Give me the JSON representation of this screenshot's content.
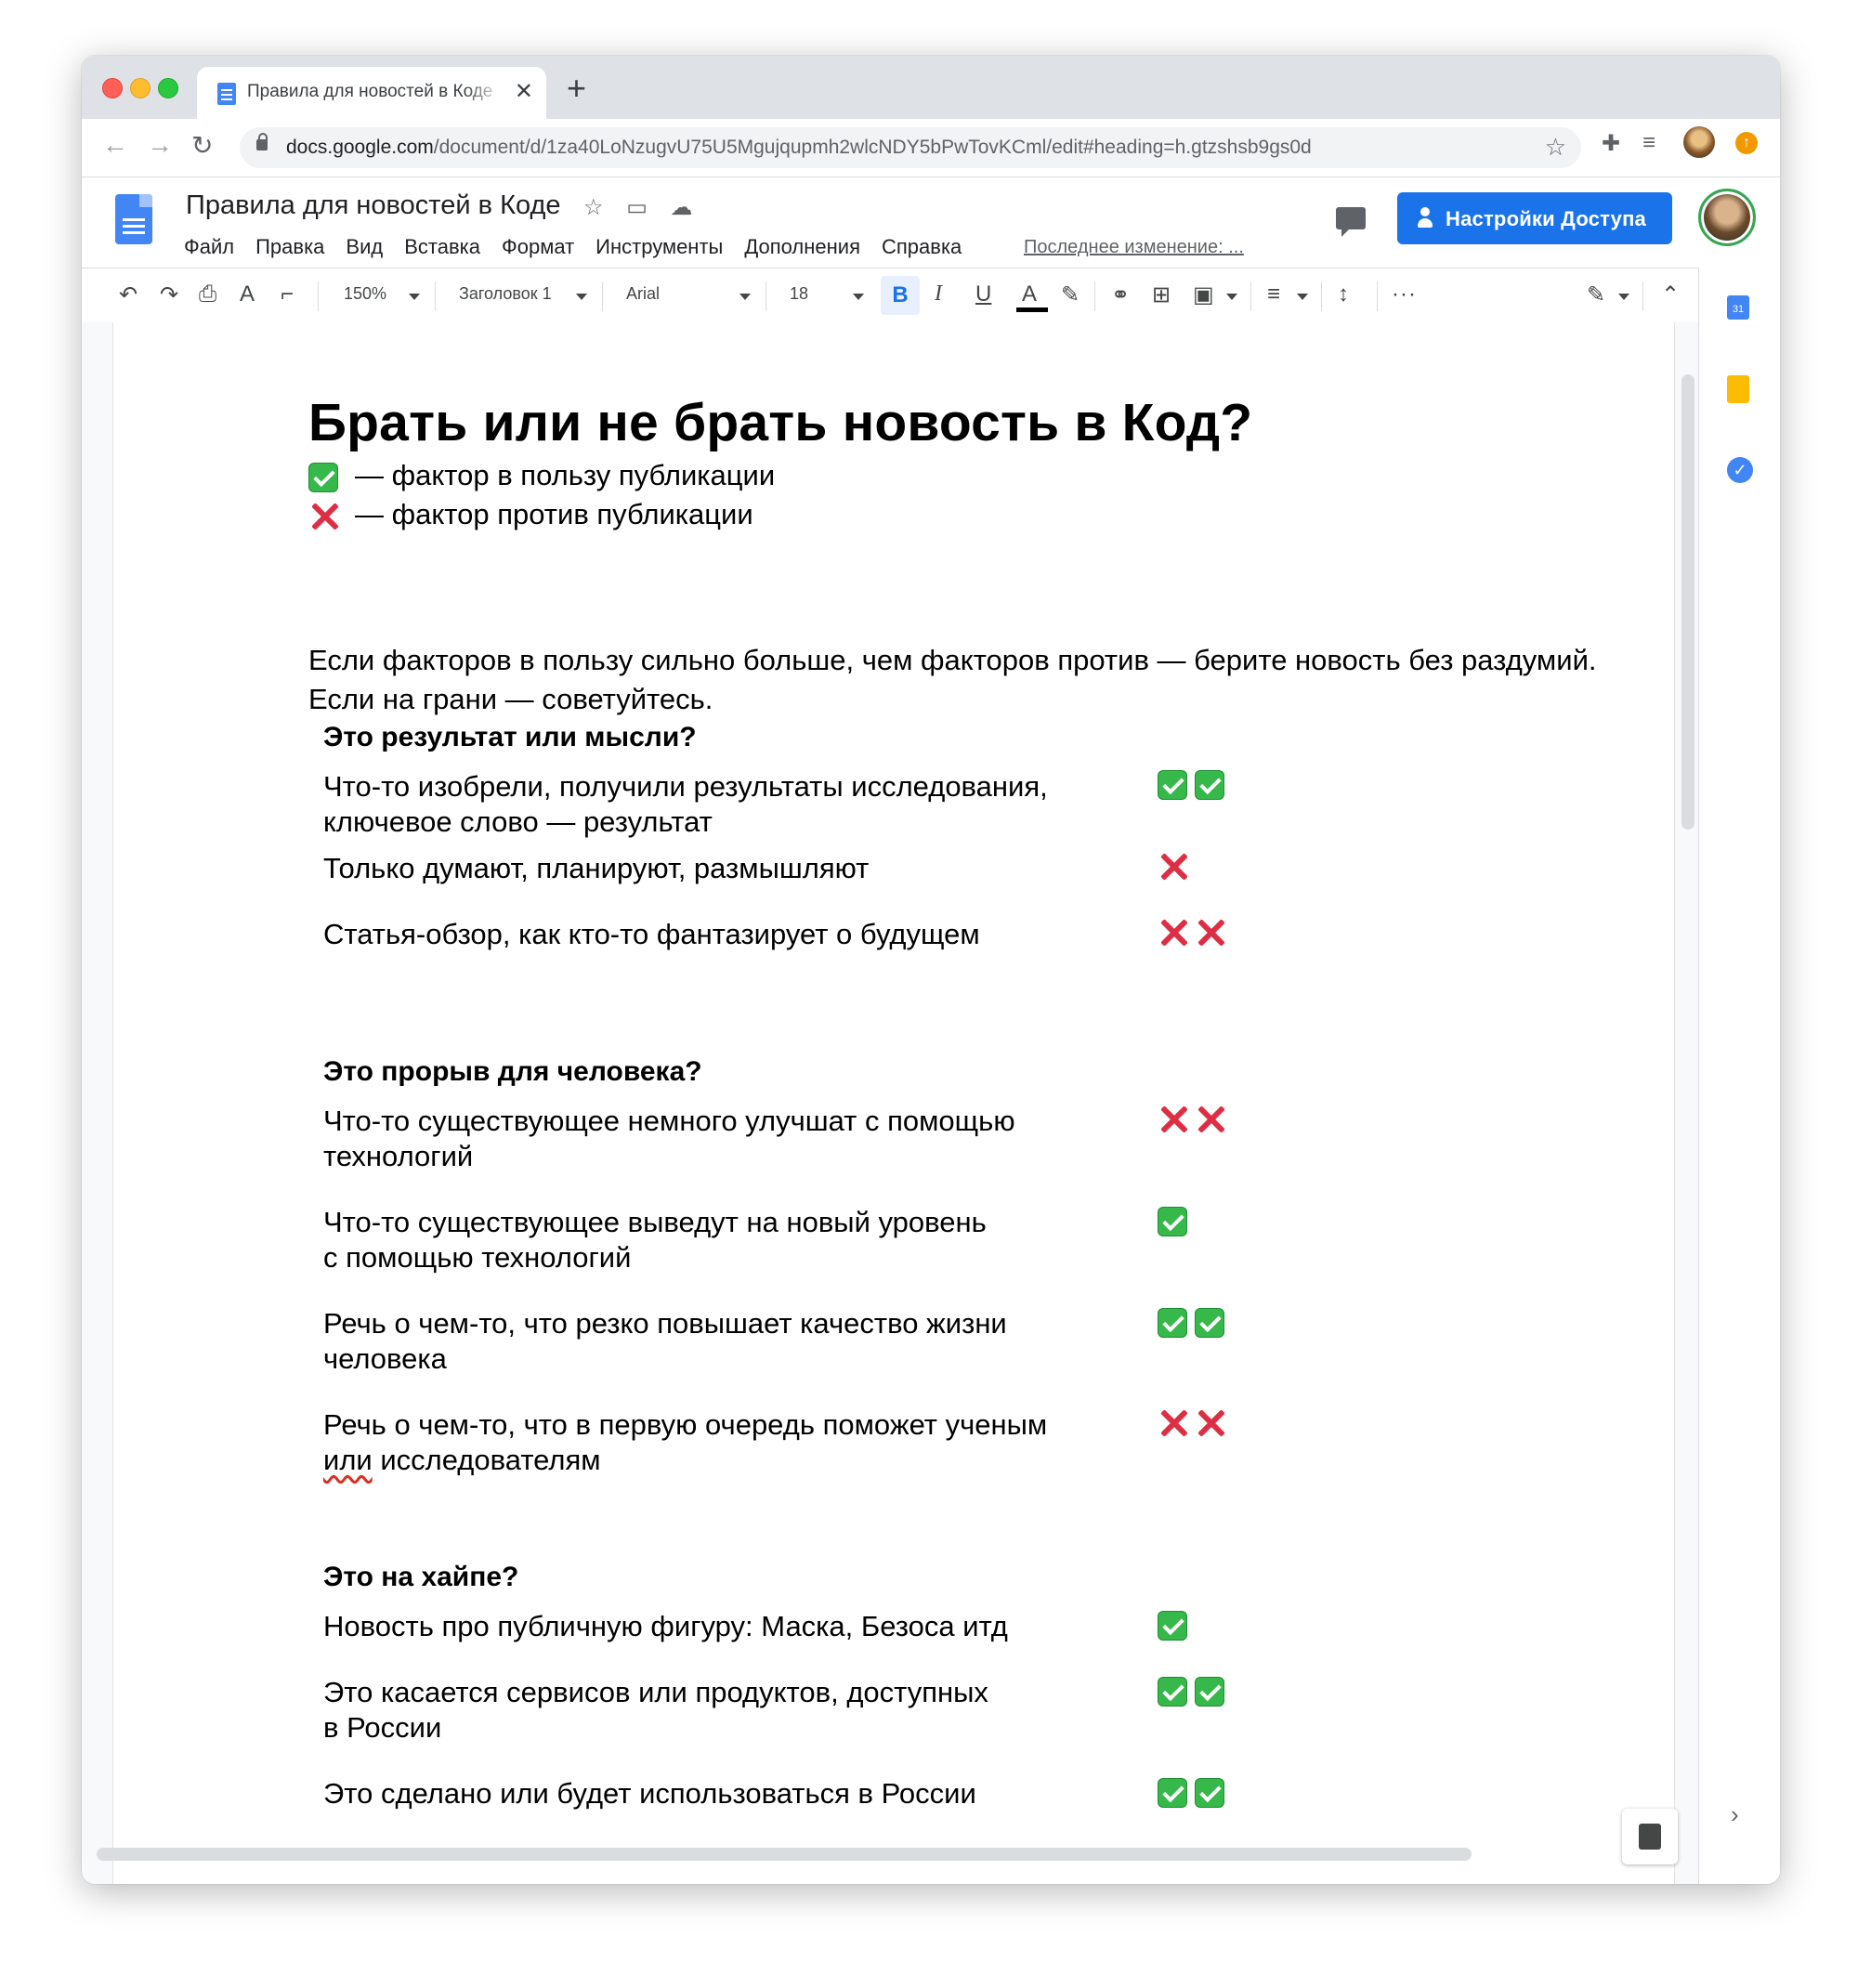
{
  "browser": {
    "tab_title": "Правила для новостей в Коде",
    "url_host": "docs.google.com",
    "url_path": "/document/d/1za40LoNzugvU75U5Mgujqupmh2wlcNDY5bPwTovKCml/edit#heading=h.gtzshsb9gs0d"
  },
  "docs": {
    "title": "Правила для новостей в Коде",
    "menu": [
      "Файл",
      "Правка",
      "Вид",
      "Вставка",
      "Формат",
      "Инструменты",
      "Дополнения",
      "Справка"
    ],
    "last_edit": "Последнее изменение: ...",
    "share_label": "Настройки Доступа"
  },
  "toolbar": {
    "zoom": "150%",
    "style": "Заголовок 1",
    "font": "Arial",
    "size": "18",
    "bold": "B",
    "italic": "I",
    "underline": "U",
    "text_color": "A",
    "more": "···"
  },
  "sidepanel": {
    "calendar_day": "31"
  },
  "document": {
    "heading": "Брать или не брать новость в Код?",
    "legend_yes": "— фактор в пользу публикации",
    "legend_no": "— фактор против публикации",
    "intro_1": "Если факторов в пользу сильно больше, чем факторов против — берите новость без раздумий.",
    "intro_2": "Если на грани — советуйтесь.",
    "sections": [
      {
        "title": "Это результат или мысли?",
        "rows": [
          {
            "l1": "Что-то изобрели, получили результаты исследования,",
            "l2": "ключевое слово — результат",
            "yes": 2,
            "no": 0
          },
          {
            "l1": "Только думают, планируют, размышляют",
            "l2": "",
            "yes": 0,
            "no": 1
          },
          {
            "l1": "Статья-обзор, как кто-то фантазирует о будущем",
            "l2": "",
            "yes": 0,
            "no": 2
          }
        ]
      },
      {
        "title": "Это прорыв для человека?",
        "rows": [
          {
            "l1": "Что-то существующее немного улучшат с помощью",
            "l2": "технологий",
            "yes": 0,
            "no": 2
          },
          {
            "l1": "Что-то существующее выведут на новый уровень",
            "l2": "с помощью технологий",
            "yes": 1,
            "no": 0
          },
          {
            "l1": "Речь о чем-то, что резко повышает качество жизни",
            "l2": "человека",
            "yes": 2,
            "no": 0
          },
          {
            "l1": "Речь о чем-то, что в первую очередь поможет ученым",
            "l2_a": "или",
            "l2_b": " исследователям",
            "yes": 0,
            "no": 2
          }
        ]
      },
      {
        "title": "Это на хайпе?",
        "rows": [
          {
            "l1": "Новость про публичную фигуру: Маска, Безоса итд",
            "l2": "",
            "yes": 1,
            "no": 0
          },
          {
            "l1": "Это касается сервисов или продуктов, доступных",
            "l2": "в России",
            "yes": 2,
            "no": 0
          },
          {
            "l1": "Это сделано или будет использоваться в России",
            "l2": "",
            "yes": 2,
            "no": 0
          }
        ]
      }
    ]
  }
}
